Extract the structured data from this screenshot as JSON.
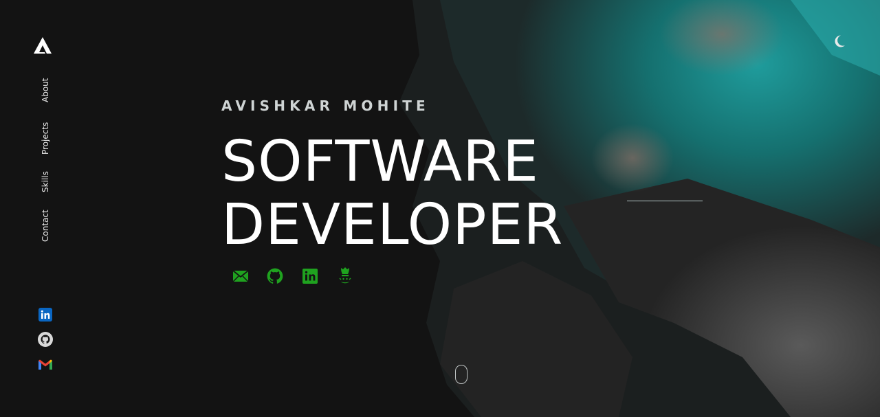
{
  "brand": {
    "logo_icon": "brand-a-logo-icon"
  },
  "nav": {
    "items": [
      {
        "label": "About"
      },
      {
        "label": "Projects"
      },
      {
        "label": "Skills"
      },
      {
        "label": "Contact"
      }
    ]
  },
  "side_social": [
    {
      "icon": "linkedin-icon",
      "color": "#0a66c2"
    },
    {
      "icon": "github-icon",
      "color": "#d9d9d9"
    },
    {
      "icon": "gmail-icon",
      "color": "#ea4335"
    }
  ],
  "theme": {
    "icon": "moon-icon"
  },
  "hero": {
    "name": "AVISHKAR MOHITE",
    "title_line1": "SOFTWARE",
    "title_line2": "DEVELOPER"
  },
  "hero_social": [
    {
      "icon": "mail-icon"
    },
    {
      "icon": "github-icon"
    },
    {
      "icon": "linkedin-icon"
    },
    {
      "icon": "codechef-icon"
    }
  ],
  "colors": {
    "background": "#131313",
    "accent_green": "#1fa21f",
    "teal": "#1c8a8a",
    "text": "#ffffff"
  },
  "scroll_indicator": {
    "icon": "mouse-scroll-icon"
  }
}
